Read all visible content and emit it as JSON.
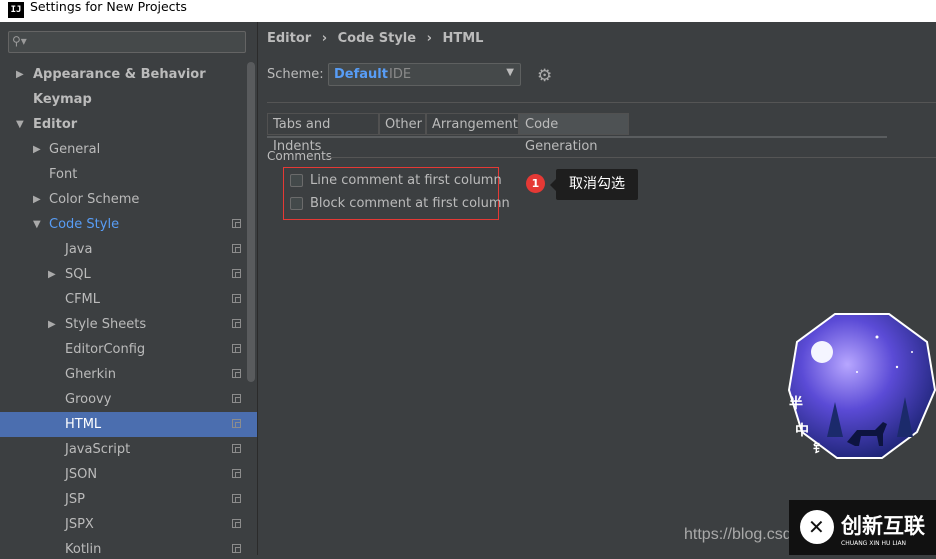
{
  "window": {
    "title": "Settings for New Projects",
    "app_icon": "IJ"
  },
  "sidebar": {
    "search_placeholder": "",
    "items": [
      {
        "label": "Appearance & Behavior",
        "arrow": "▶",
        "level": 0,
        "bold": true
      },
      {
        "label": "Keymap",
        "arrow": "",
        "level": 0,
        "bold": true
      },
      {
        "label": "Editor",
        "arrow": "▼",
        "level": 0,
        "bold": true
      },
      {
        "label": "General",
        "arrow": "▶",
        "level": 1
      },
      {
        "label": "Font",
        "arrow": "",
        "level": 1
      },
      {
        "label": "Color Scheme",
        "arrow": "▶",
        "level": 1
      },
      {
        "label": "Code Style",
        "arrow": "▼",
        "level": 1,
        "copy": true
      },
      {
        "label": "Java",
        "arrow": "",
        "level": 2,
        "copy": true
      },
      {
        "label": "SQL",
        "arrow": "▶",
        "level": 2,
        "copy": true
      },
      {
        "label": "CFML",
        "arrow": "",
        "level": 2,
        "copy": true
      },
      {
        "label": "Style Sheets",
        "arrow": "▶",
        "level": 2,
        "copy": true
      },
      {
        "label": "EditorConfig",
        "arrow": "",
        "level": 2,
        "copy": true
      },
      {
        "label": "Gherkin",
        "arrow": "",
        "level": 2,
        "copy": true
      },
      {
        "label": "Groovy",
        "arrow": "",
        "level": 2,
        "copy": true
      },
      {
        "label": "HTML",
        "arrow": "",
        "level": 2,
        "copy": true,
        "selected": true
      },
      {
        "label": "JavaScript",
        "arrow": "",
        "level": 2,
        "copy": true
      },
      {
        "label": "JSON",
        "arrow": "",
        "level": 2,
        "copy": true
      },
      {
        "label": "JSP",
        "arrow": "",
        "level": 2,
        "copy": true
      },
      {
        "label": "JSPX",
        "arrow": "",
        "level": 2,
        "copy": true
      },
      {
        "label": "Kotlin",
        "arrow": "",
        "level": 2,
        "copy": true
      }
    ]
  },
  "breadcrumb": {
    "sep": "›",
    "parts": [
      "Editor",
      "Code Style",
      "HTML"
    ]
  },
  "scheme": {
    "label": "Scheme:",
    "value": "Default",
    "sub": "IDE"
  },
  "tabs": [
    "Tabs and Indents",
    "Other",
    "Arrangement",
    "Code Generation"
  ],
  "active_tab": "Code Generation",
  "comments": {
    "group_label": "Comments",
    "options": [
      {
        "label": "Line comment at first column",
        "checked": false
      },
      {
        "label": "Block comment at first column",
        "checked": false
      }
    ]
  },
  "annotation": {
    "badge": "1",
    "tooltip": "取消勾选"
  },
  "watermark": {
    "text": "https://blog.csd",
    "logo_text": "创新互联",
    "logo_sub": "CHUANG XIN HU LIAN"
  },
  "avatar": {
    "chars": [
      "半",
      "中",
      "钅"
    ]
  },
  "colors": {
    "accent": "#589df6",
    "selection": "#4b6eaf",
    "highlight_red": "#e53935"
  }
}
